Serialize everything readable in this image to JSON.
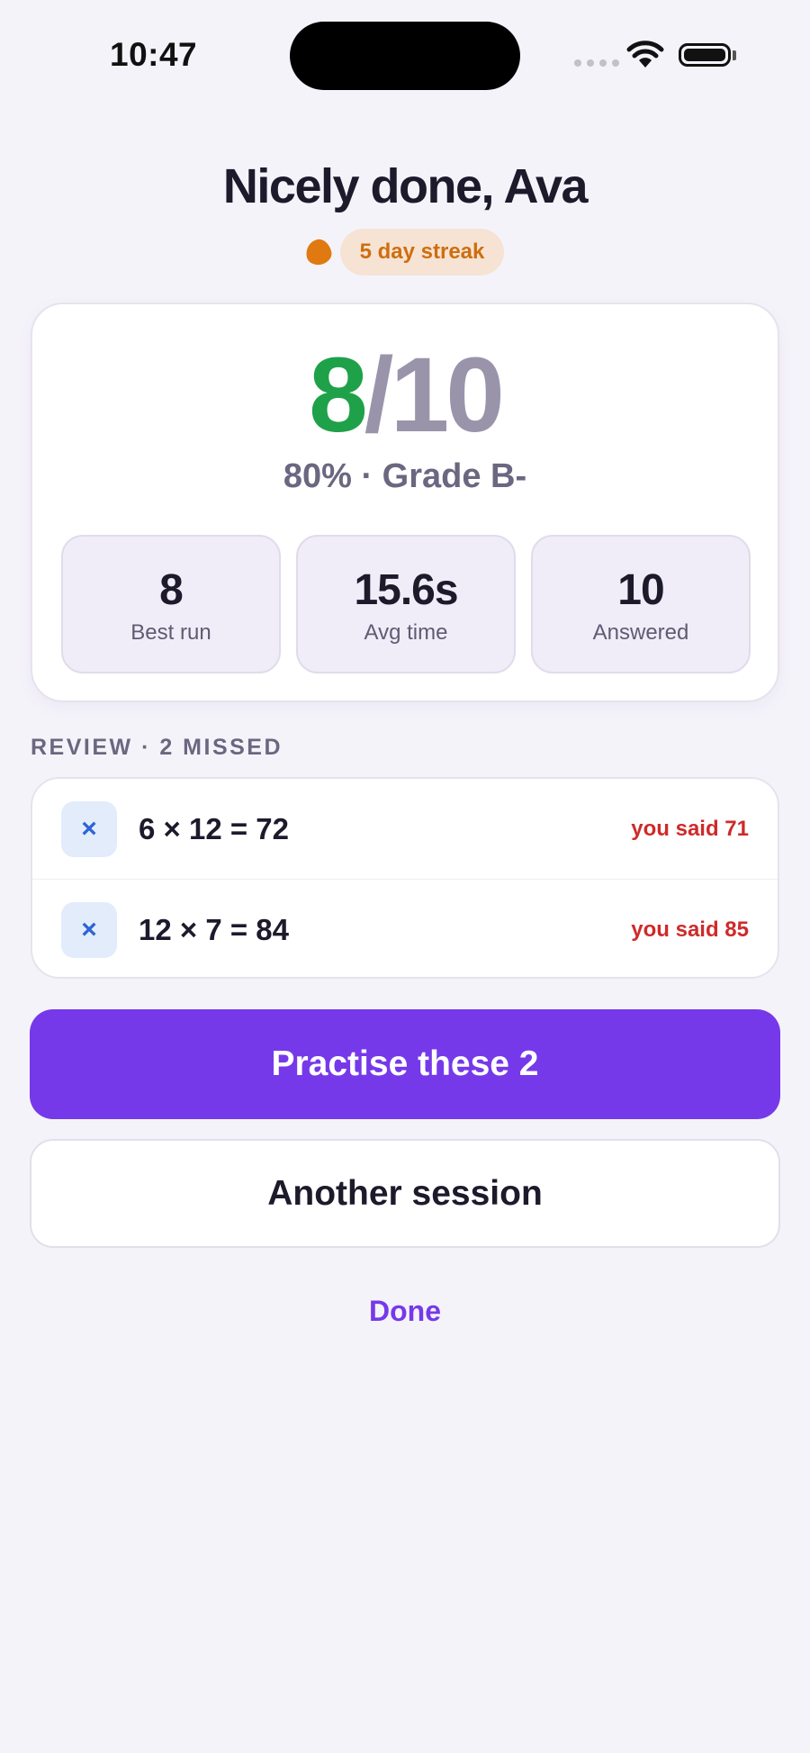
{
  "status_bar": {
    "time": "10:47",
    "wifi_icon": "wifi-icon",
    "battery_icon": "battery-icon"
  },
  "header": {
    "title": "Nicely done, Ava",
    "streak_icon": "flame-icon",
    "streak_label": "5 day streak"
  },
  "score": {
    "correct": "8",
    "separator": "/",
    "total": "10",
    "summary": "80% · Grade B-",
    "colors": {
      "correct": "#1fa14a",
      "total": "#9a94ab"
    }
  },
  "stats": [
    {
      "value": "8",
      "label": "Best run"
    },
    {
      "value": "15.6s",
      "label": "Avg time"
    },
    {
      "value": "10",
      "label": "Answered"
    }
  ],
  "review": {
    "heading": "REVIEW · 2 MISSED",
    "items": [
      {
        "icon": "×",
        "equation": "6 × 12 = 72",
        "you_said": "you said 71"
      },
      {
        "icon": "×",
        "equation": "12 × 7 = 84",
        "you_said": "you said 85"
      }
    ]
  },
  "actions": {
    "primary": "Practise these 2",
    "secondary": "Another session",
    "done": "Done"
  },
  "colors": {
    "accent": "#7639ea",
    "error": "#cf2a2a",
    "streak": "#cf6e0e"
  }
}
